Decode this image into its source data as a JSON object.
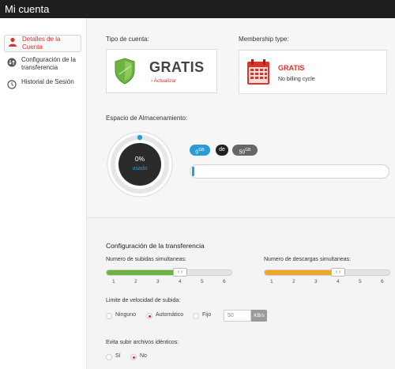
{
  "window": {
    "title": "Mi cuenta"
  },
  "sidebar": {
    "items": [
      {
        "label": "Detalles de la Cuenta",
        "icon": "user-icon",
        "active": true
      },
      {
        "label": "Configuración de la transferencia",
        "icon": "transfer-icon",
        "active": false
      },
      {
        "label": "Historial de Sesión",
        "icon": "clock-icon",
        "active": false
      }
    ]
  },
  "account": {
    "type_label": "Tipo de cuenta:",
    "plan_name": "GRATIS",
    "upgrade_link": "› Actualizar",
    "membership_label": "Membership type:",
    "membership_plan": "GRATIS",
    "billing_cycle": "No billing cycle"
  },
  "storage": {
    "label": "Espacio de Almacenamiento:",
    "percent_text": "0%",
    "used_text": "usado",
    "used_fraction": 0.0,
    "used_value": "0",
    "used_unit": "GB",
    "of_text": "de",
    "total_value": "50",
    "total_unit": "GB"
  },
  "transfer": {
    "section_title": "Configuración de la transferencia",
    "uploads_label": "Numero de subidas simultaneas:",
    "downloads_label": "Numero de descargas simultaneas:",
    "upload_slider": {
      "value": 4,
      "min": 1,
      "max": 6,
      "ticks": [
        "1",
        "2",
        "3",
        "4",
        "5",
        "6"
      ]
    },
    "download_slider": {
      "value": 4,
      "min": 1,
      "max": 6,
      "ticks": [
        "1",
        "2",
        "3",
        "4",
        "5",
        "6"
      ]
    },
    "speed_label": "Limite de velocidad de subida:",
    "speed_options": [
      "Ninguno",
      "Automático",
      "Fijo"
    ],
    "speed_selected": "Automático",
    "speed_value": "50",
    "speed_unit": "KB/s",
    "dup_label": "Evita subir archivos idénticos:",
    "dup_options": [
      "Sí",
      "No"
    ],
    "dup_selected": "No"
  },
  "colors": {
    "accent": "#d9332a",
    "upload_bar": "#6db33f",
    "download_bar": "#f0a728",
    "shield": "#6db33f"
  }
}
